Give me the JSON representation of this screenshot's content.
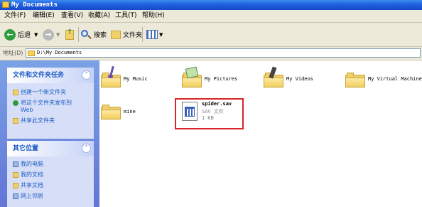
{
  "window": {
    "title": "My Documents"
  },
  "menu": [
    "文件(F)",
    "编辑(E)",
    "查看(V)",
    "收藏(A)",
    "工具(T)",
    "帮助(H)"
  ],
  "toolbar": {
    "back": "后退",
    "search": "搜索",
    "folders": "文件夹"
  },
  "address": {
    "label": "地址(D)",
    "value": "D:\\My Documents"
  },
  "tasks_panel": {
    "title": "文件和文件夹任务",
    "items": [
      "创建一个新文件夹",
      "将这个文件夹发布到",
      "Web",
      "共享此文件夹"
    ]
  },
  "places_panel": {
    "title": "其它位置",
    "items": [
      "我的电脑",
      "我的文档",
      "共享文档",
      "网上邻居"
    ]
  },
  "folders": [
    {
      "name": "My Music",
      "icon": "music-folder-icon"
    },
    {
      "name": "My Pictures",
      "icon": "pictures-folder-icon"
    },
    {
      "name": "My Videos",
      "icon": "videos-folder-icon"
    },
    {
      "name": "My Virtual Machines",
      "icon": "folder-icon"
    },
    {
      "name": "mine",
      "icon": "folder-icon"
    }
  ],
  "file": {
    "name": "spider.sav",
    "type": "SAV 文件",
    "size": "1 KB",
    "icon": "spss-data-file-icon"
  },
  "colors": {
    "titlebar": "#1f5fde",
    "highlight": "#d8242a",
    "link": "#215dc6",
    "pane": "#6f8edf"
  }
}
